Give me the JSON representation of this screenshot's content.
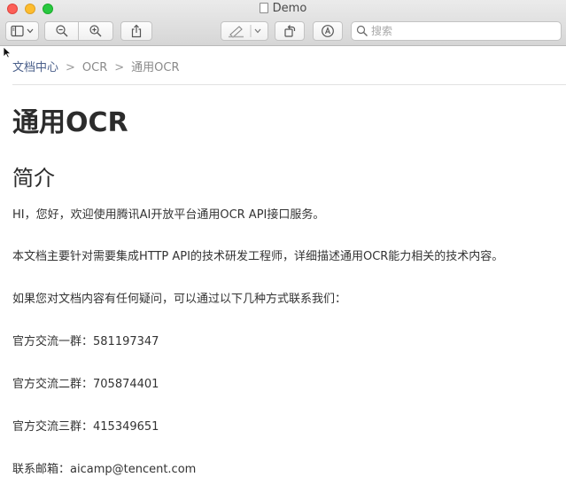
{
  "window": {
    "title": "Demo"
  },
  "toolbar": {
    "sidebar_icon": "sidebar-toggle-icon",
    "zoom_out_icon": "zoom-out-icon",
    "zoom_in_icon": "zoom-in-icon",
    "share_icon": "share-icon",
    "markup_icon": "highlighter-icon",
    "rotate_icon": "rotate-icon",
    "annotate_icon": "markup-icon",
    "search_placeholder": "搜索"
  },
  "breadcrumb": {
    "items": [
      "文档中心",
      "OCR",
      "通用OCR"
    ],
    "separator": ">"
  },
  "page": {
    "title": "通用OCR",
    "section_title": "简介",
    "paragraphs": [
      "HI，您好，欢迎使用腾讯AI开放平台通用OCR API接口服务。",
      "本文档主要针对需要集成HTTP API的技术研发工程师，详细描述通用OCR能力相关的技术内容。",
      "如果您对文档内容有任何疑问，可以通过以下几种方式联系我们：",
      "官方交流一群：581197347",
      "官方交流二群：705874401",
      "官方交流三群：415349651",
      "联系邮箱：aicamp@tencent.com"
    ]
  },
  "colors": {
    "close": "#fc5f57",
    "minimize": "#fdbc2e",
    "maximize": "#28c840",
    "link": "#4a5f8a"
  }
}
